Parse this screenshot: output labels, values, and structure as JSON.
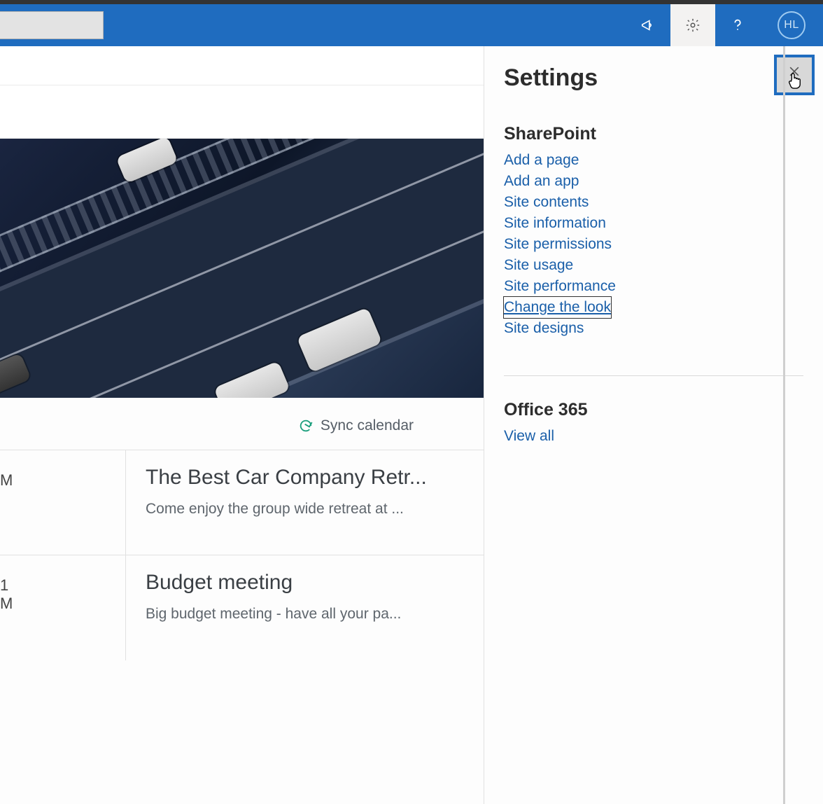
{
  "header": {
    "avatar_initials": "HL"
  },
  "content": {
    "sync_label": "Sync calendar",
    "events": [
      {
        "time_line1": "",
        "time_line2": "M",
        "title": "The Best Car Company Retr...",
        "desc": "Come enjoy the group wide retreat at ..."
      },
      {
        "time_line1": "1",
        "time_line2": "M",
        "title": "Budget meeting",
        "desc": "Big budget meeting - have all your pa..."
      }
    ]
  },
  "settings": {
    "panel_title": "Settings",
    "sections": [
      {
        "heading": "SharePoint",
        "links": [
          {
            "label": "Add a page",
            "focused": false
          },
          {
            "label": "Add an app",
            "focused": false
          },
          {
            "label": "Site contents",
            "focused": false
          },
          {
            "label": "Site information",
            "focused": false
          },
          {
            "label": "Site permissions",
            "focused": false
          },
          {
            "label": "Site usage",
            "focused": false
          },
          {
            "label": "Site performance",
            "focused": false
          },
          {
            "label": "Change the look",
            "focused": true
          },
          {
            "label": "Site designs",
            "focused": false
          }
        ]
      },
      {
        "heading": "Office 365",
        "links": [
          {
            "label": "View all",
            "focused": false
          }
        ]
      }
    ]
  }
}
